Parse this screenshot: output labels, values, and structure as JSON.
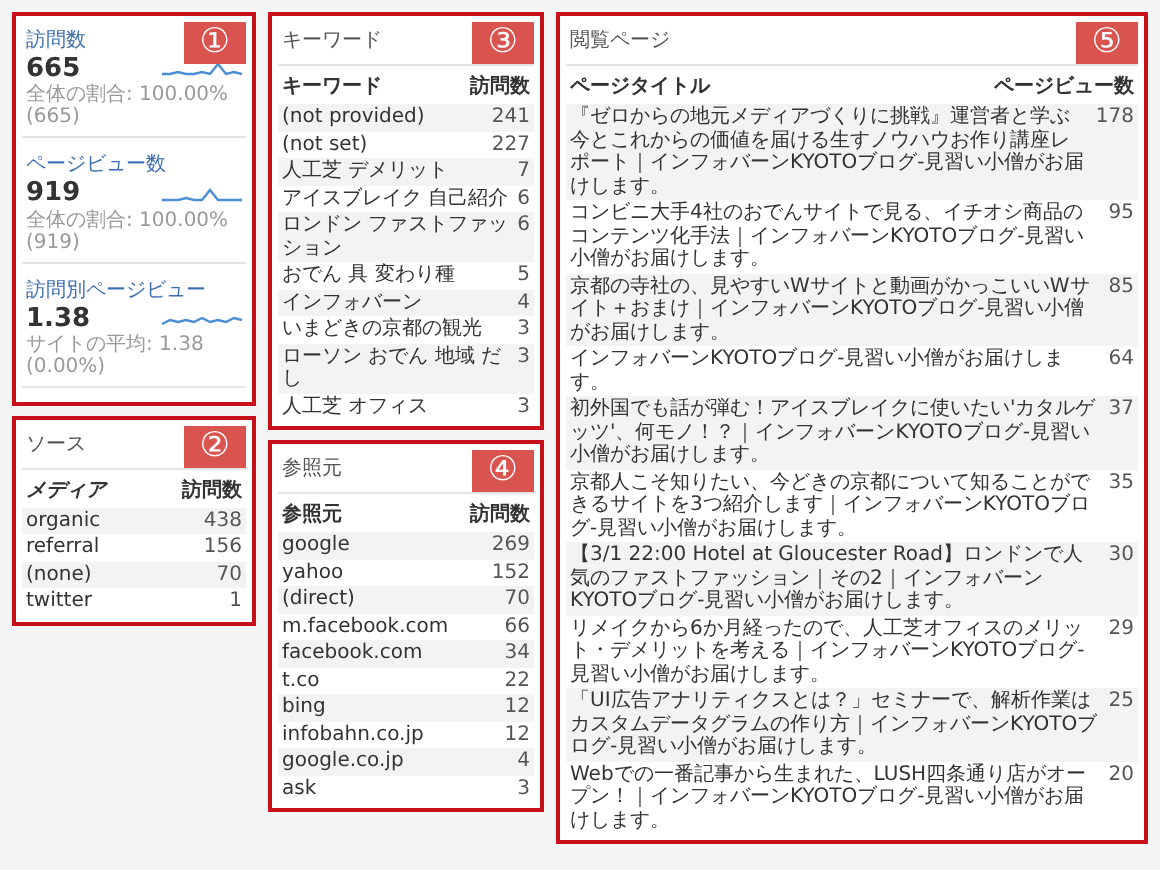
{
  "panels": [
    {
      "number": "①",
      "kind": "metrics",
      "metrics": [
        {
          "label": "訪問数",
          "value": "665",
          "note": "全体の割合: 100.00% (665)"
        },
        {
          "label": "ページビュー数",
          "value": "919",
          "note": "全体の割合: 100.00% (919)"
        },
        {
          "label": "訪問別ページビュー",
          "value": "1.38",
          "note": "サイトの平均: 1.38 (0.00%)"
        }
      ]
    },
    {
      "number": "②",
      "kind": "table",
      "title": "ソース",
      "columns": [
        "メディア",
        "訪問数"
      ],
      "rows": [
        {
          "label": "organic",
          "value": "438"
        },
        {
          "label": "referral",
          "value": "156"
        },
        {
          "label": "(none)",
          "value": "70"
        },
        {
          "label": "twitter",
          "value": "1"
        }
      ]
    },
    {
      "number": "③",
      "kind": "table",
      "title": "キーワード",
      "columns": [
        "キーワード",
        "訪問数"
      ],
      "rows": [
        {
          "label": "(not provided)",
          "value": "241"
        },
        {
          "label": "(not set)",
          "value": "227"
        },
        {
          "label": "人工芝 デメリット",
          "value": "7"
        },
        {
          "label": "アイスブレイク 自己紹介",
          "value": "6"
        },
        {
          "label": "ロンドン ファストファッション",
          "value": "6"
        },
        {
          "label": "おでん 具 変わり種",
          "value": "5"
        },
        {
          "label": "インフォバーン",
          "value": "4"
        },
        {
          "label": "いまどきの京都の観光",
          "value": "3"
        },
        {
          "label": "ローソン おでん 地域 だし",
          "value": "3"
        },
        {
          "label": "人工芝 オフィス",
          "value": "3"
        }
      ]
    },
    {
      "number": "④",
      "kind": "table",
      "title": "参照元",
      "columns": [
        "参照元",
        "訪問数"
      ],
      "rows": [
        {
          "label": "google",
          "value": "269"
        },
        {
          "label": "yahoo",
          "value": "152"
        },
        {
          "label": "(direct)",
          "value": "70"
        },
        {
          "label": "m.facebook.com",
          "value": "66"
        },
        {
          "label": "facebook.com",
          "value": "34"
        },
        {
          "label": "t.co",
          "value": "22"
        },
        {
          "label": "bing",
          "value": "12"
        },
        {
          "label": "infobahn.co.jp",
          "value": "12"
        },
        {
          "label": "google.co.jp",
          "value": "4"
        },
        {
          "label": "ask",
          "value": "3"
        }
      ]
    },
    {
      "number": "⑤",
      "kind": "table",
      "title": "閲覧ページ",
      "columns": [
        "ページタイトル",
        "ページビュー数"
      ],
      "rows": [
        {
          "label": "『ゼロからの地元メディアづくりに挑戦』運営者と学ぶ今とこれからの価値を届ける生すノウハウお作り講座レポート｜インフォバーンKYOTOブログ-見習い小僧がお届けします。",
          "value": "178"
        },
        {
          "label": "コンビニ大手4社のおでんサイトで見る、イチオシ商品のコンテンツ化手法｜インフォバーンKYOTOブログ-見習い小僧がお届けします。",
          "value": "95"
        },
        {
          "label": "京都の寺社の、見やすいWサイトと動画がかっこいいWサイト＋おまけ｜インフォバーンKYOTOブログ-見習い小僧がお届けします。",
          "value": "85"
        },
        {
          "label": "インフォバーンKYOTOブログ-見習い小僧がお届けします。",
          "value": "64"
        },
        {
          "label": "初外国でも話が弾む！アイスブレイクに使いたい'カタルゲッツ'、何モノ！？｜インフォバーンKYOTOブログ-見習い小僧がお届けします。",
          "value": "37"
        },
        {
          "label": "京都人こそ知りたい、今どきの京都について知ることができるサイトを3つ紹介します｜インフォバーンKYOTOブログ-見習い小僧がお届けします。",
          "value": "35"
        },
        {
          "label": "【3/1 22:00 Hotel at Gloucester Road】ロンドンで人気のファストファッション｜その2｜インフォバーンKYOTOブログ-見習い小僧がお届けします。",
          "value": "30"
        },
        {
          "label": "リメイクから6か月経ったので、人工芝オフィスのメリット・デメリットを考える｜インフォバーンKYOTOブログ-見習い小僧がお届けします。",
          "value": "29"
        },
        {
          "label": "「UI広告アナリティクスとは？」セミナーで、解析作業はカスタムデータグラムの作り方｜インフォバーンKYOTOブログ-見習い小僧がお届けします。",
          "value": "25"
        },
        {
          "label": "Webでの一番記事から生まれた、LUSH四条通り店がオープン！｜インフォバーンKYOTOブログ-見習い小僧がお届けします。",
          "value": "20"
        }
      ]
    }
  ]
}
